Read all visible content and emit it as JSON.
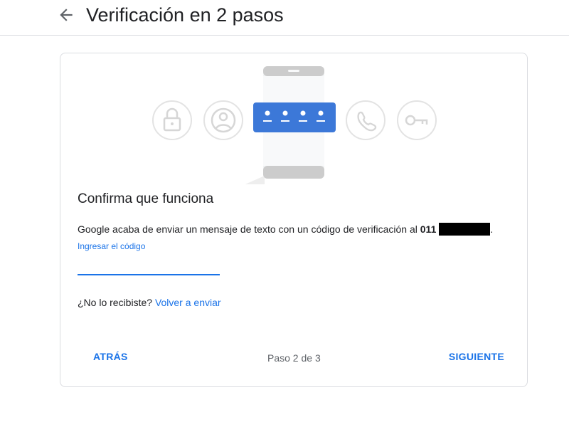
{
  "header": {
    "title": "Verificación en 2 pasos",
    "back_icon": "arrow-back-icon"
  },
  "illustration": {
    "icons": [
      "lock-icon",
      "account-circle-icon",
      "password-dots-icon",
      "phone-icon",
      "key-icon"
    ],
    "accent_color": "#3c78d8"
  },
  "content": {
    "title": "Confirma que funciona",
    "message": "Google acaba de enviar un mensaje de texto con un código de verificación al",
    "phone_prefix": "011",
    "code_label": "Ingresar el código",
    "code_value": "",
    "resend_prompt": "¿No lo recibiste?",
    "resend_link": "Volver a enviar"
  },
  "footer": {
    "back_label": "ATRÁS",
    "step_label": "Paso 2 de 3",
    "next_label": "SIGUIENTE"
  },
  "colors": {
    "accent": "#1a73e8",
    "text": "#202124",
    "muted": "#5f6368",
    "border": "#dadce0"
  }
}
